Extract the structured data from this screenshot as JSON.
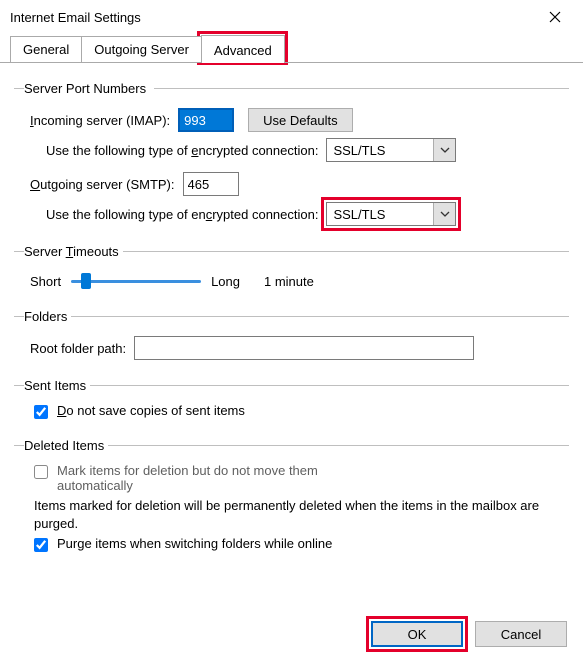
{
  "window": {
    "title": "Internet Email Settings"
  },
  "tabs": {
    "general": "General",
    "outgoing": "Outgoing Server",
    "advanced": "Advanced"
  },
  "group": {
    "ports": "Server Port Numbers",
    "timeouts": "Server Timeouts",
    "folders": "Folders",
    "sent": "Sent Items",
    "deleted": "Deleted Items"
  },
  "ports": {
    "incoming_label_pre": "I",
    "incoming_label": "ncoming server (IMAP):",
    "incoming_value": "993",
    "use_defaults": "Use Defaults",
    "enc_label_pre": "Use the following type of ",
    "enc_label_u": "e",
    "enc_label_post": "ncrypted connection:",
    "enc_in_value": "SSL/TLS",
    "outgoing_label_pre": "O",
    "outgoing_label": "utgoing server (SMTP):",
    "outgoing_value": "465",
    "enc_out_label_pre": "Use the following type of en",
    "enc_out_label_u": "c",
    "enc_out_label_post": "rypted connection:",
    "enc_out_value": "SSL/TLS"
  },
  "timeouts": {
    "short": "Short",
    "long": "Long",
    "value": "1 minute"
  },
  "folders": {
    "root_label": "Root folder path:",
    "root_value": ""
  },
  "sent": {
    "dont_save": "Do not save copies of sent items",
    "dont_save_u": "D"
  },
  "deleted": {
    "mark_line1": "Mark items for deletion but do not move them",
    "mark_line2": "automatically",
    "note": "Items marked for deletion will be permanently deleted when the items in the mailbox are purged.",
    "purge": "Purge items when switching folders while online"
  },
  "buttons": {
    "ok": "OK",
    "cancel": "Cancel"
  }
}
